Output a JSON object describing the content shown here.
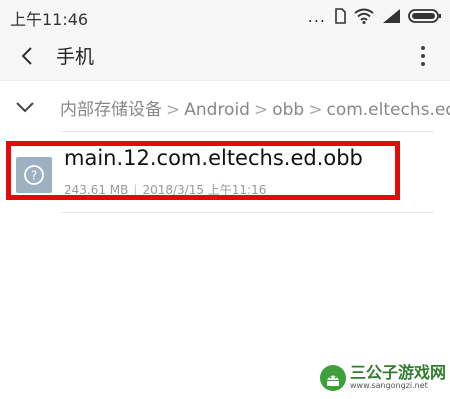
{
  "status_bar": {
    "time": "上午11:46",
    "more": "..."
  },
  "header": {
    "title": "手机"
  },
  "breadcrumb": {
    "items": [
      "内部存储设备",
      "Android",
      "obb",
      "com.eltechs.ed"
    ],
    "separator": ">"
  },
  "file": {
    "name": "main.12.com.eltechs.ed.obb",
    "size": "243.61 MB",
    "date": "2018/3/15 上午11:16",
    "meta_separator": "|"
  },
  "watermark": {
    "brand": "三公子游戏网",
    "url": "www.sangongzi.net"
  },
  "colors": {
    "highlight": "#e20a0a",
    "file_icon": "#9eb1c3"
  }
}
